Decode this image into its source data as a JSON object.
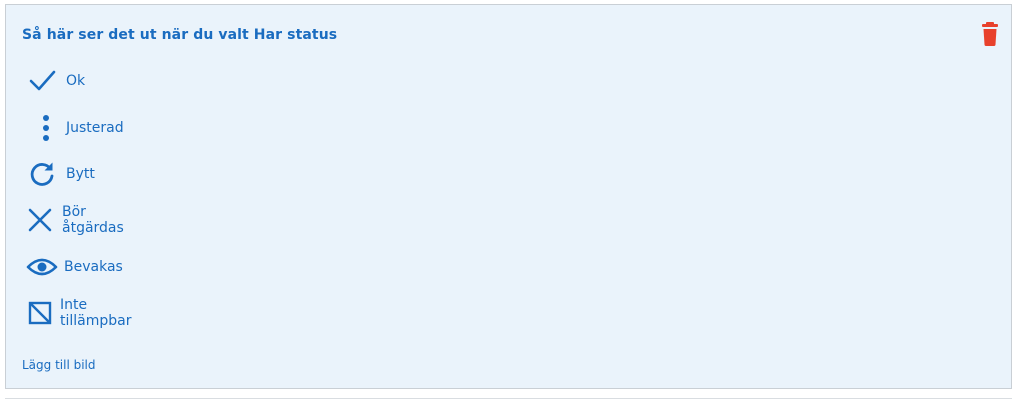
{
  "card": {
    "title": "Så här ser det ut när du valt Har status",
    "add_image_label": "Lägg till bild"
  },
  "statuses": [
    {
      "label": "Ok",
      "icon": "checkmark-icon"
    },
    {
      "label": "Justerad",
      "icon": "vertical-dots-icon"
    },
    {
      "label": "Bytt",
      "icon": "refresh-icon"
    },
    {
      "label": "Bör åtgärdas",
      "icon": "x-mark-icon"
    },
    {
      "label": "Bevakas",
      "icon": "eye-icon"
    },
    {
      "label": "Inte tillämpbar",
      "icon": "not-applicable-icon"
    }
  ],
  "colors": {
    "accent": "#1a6cc0",
    "card_background": "#eaf3fb",
    "delete": "#e8412c"
  }
}
